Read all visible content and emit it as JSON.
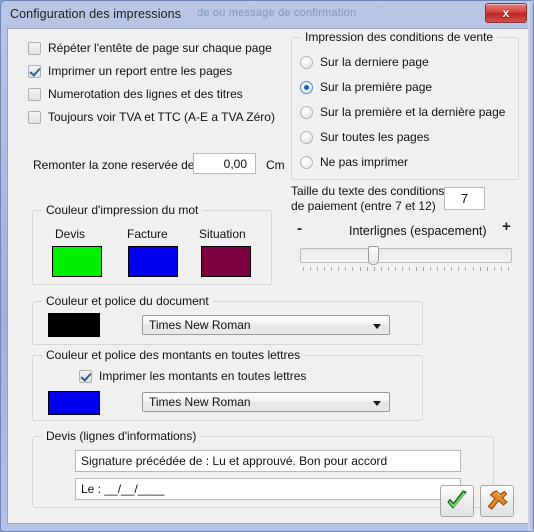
{
  "window": {
    "title": "Configuration des impressions",
    "ghost_title": "de ou message de confirmation",
    "close_label": "x"
  },
  "print_options": {
    "items": [
      {
        "label": "Répéter l'entête de page sur chaque page",
        "checked": false
      },
      {
        "label": "Imprimer un report entre les pages",
        "checked": true
      },
      {
        "label": "Numerotation des lignes et des titres",
        "checked": false
      },
      {
        "label": "Toujours voir TVA et TTC (A-E  a TVA Zéro)",
        "checked": false
      }
    ]
  },
  "reserved_zone": {
    "label": "Remonter la zone reservée de :",
    "value": "0,00",
    "unit": "Cm"
  },
  "sale_conditions": {
    "title": "Impression des conditions de vente",
    "options": [
      {
        "label": "Sur la derniere page",
        "selected": false
      },
      {
        "label": "Sur la première page",
        "selected": true
      },
      {
        "label": "Sur la première et la dernière page",
        "selected": false
      },
      {
        "label": "Sur toutes les pages",
        "selected": false
      },
      {
        "label": "Ne pas imprimer",
        "selected": false
      }
    ]
  },
  "word_color": {
    "title": "Couleur d'impression du mot",
    "swatches": [
      {
        "label": "Devis",
        "color": "#00f000"
      },
      {
        "label": "Facture",
        "color": "#0000ee"
      },
      {
        "label": "Situation",
        "color": "#7d0040"
      }
    ]
  },
  "payment_text_size": {
    "label_line1": "Taille du texte des conditions",
    "label_line2": "de paiement (entre 7 et 12)",
    "value": "7"
  },
  "line_spacing": {
    "minus": "-",
    "label": "Interlignes (espacement)",
    "plus": "+",
    "position_percent": 32
  },
  "document_font": {
    "title": "Couleur et police du document",
    "color": "#000000",
    "font": "Times New Roman"
  },
  "amounts_font": {
    "title": "Couleur et police des montants en toutes lettres",
    "checkbox_label": "Imprimer les montants en toutes lettres",
    "checkbox_checked": true,
    "color": "#0000ee",
    "font": "Times New Roman"
  },
  "quote_lines": {
    "title": "Devis (lignes d'informations)",
    "line1": "Signature précédée de : Lu et approuvé. Bon pour accord",
    "line2": "Le : __/__/____"
  },
  "footer": {
    "validate_icon": "green-check-icon",
    "cancel_icon": "orange-exit-arrow-icon"
  }
}
